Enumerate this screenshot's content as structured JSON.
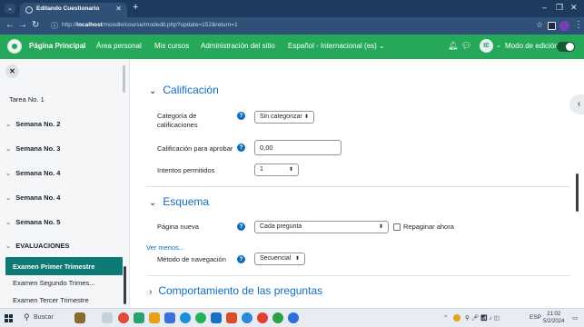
{
  "browser": {
    "tab_title": "Editando Cuestionario",
    "url_prefix": "http://",
    "url_host": "localhost",
    "url_path": "/moodle/course/modedit.php?update=152&return=1"
  },
  "navbar": {
    "home": "Página Principal",
    "personal_area": "Área personal",
    "my_courses": "Mis cursos",
    "site_admin": "Administración del sitio",
    "language": "Español - Internacional (es) ⌄",
    "avatar_initials": "IE",
    "edit_mode": "Modo de edición"
  },
  "sidebar": {
    "partial_item": "Tarea No. 1",
    "sections": [
      "Semana No. 2",
      "Semana No. 3",
      "Semana No. 4",
      "Semana No. 4",
      "Semana No. 5",
      "EVALUACIONES"
    ],
    "active_item": "Examen Primer Trimestre",
    "items": [
      "Examen Segundo Trimes...",
      "Examen Tercer Trimestre"
    ]
  },
  "calificacion": {
    "header": "Calificación",
    "category_label": "Categoría de calificaciones",
    "category_value": "Sin categorizar",
    "pass_label": "Calificación para aprobar",
    "pass_value": "0,00",
    "attempts_label": "Intentos permitidos",
    "attempts_value": "1"
  },
  "esquema": {
    "header": "Esquema",
    "new_page_label": "Página nueva",
    "new_page_value": "Cada pregunta",
    "repaginate_label": "Repaginar ahora",
    "show_less": "Ver menos...",
    "nav_method_label": "Método de navegación",
    "nav_method_value": "Secuencial"
  },
  "comportamiento": {
    "header": "Comportamiento de las preguntas"
  },
  "taskbar": {
    "search": "Buscar",
    "language": "ESP",
    "time": "21:02",
    "date": "5/2/2024"
  },
  "colors": {
    "navbar": "#26a85a",
    "sidebar_active": "#0d7a76",
    "link": "#0f6cbf",
    "browser_chrome": "#1f3a5f"
  }
}
